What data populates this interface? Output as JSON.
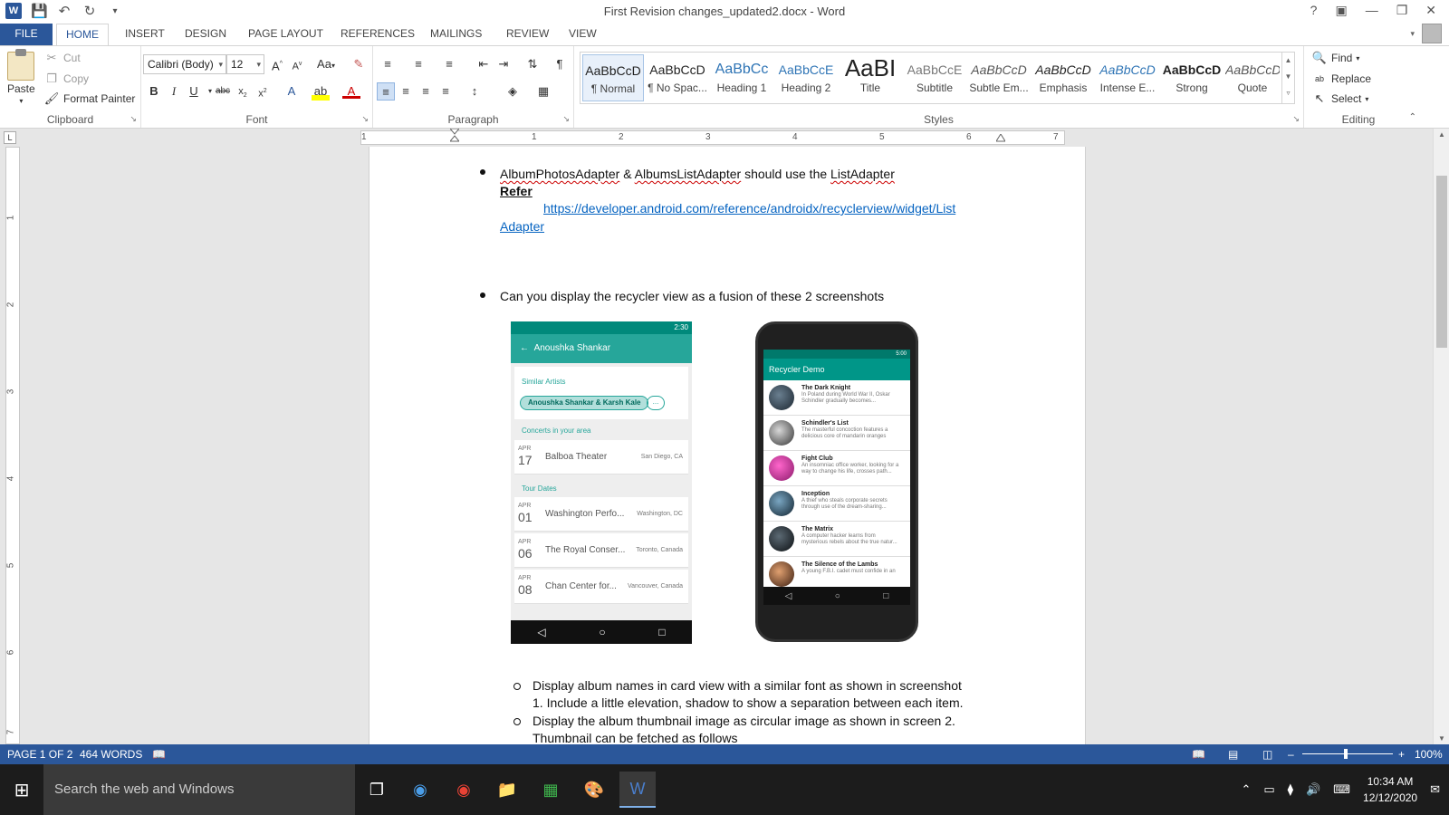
{
  "window": {
    "title": "First Revision changes_updated2.docx - Word",
    "controls": [
      "?",
      "▣",
      "—",
      "❐",
      "✕"
    ]
  },
  "qat": {
    "undo_icon": "undo-icon",
    "redo_icon": "redo-icon",
    "save_icon": "save-icon"
  },
  "tabs": [
    "FILE",
    "HOME",
    "INSERT",
    "DESIGN",
    "PAGE LAYOUT",
    "REFERENCES",
    "MAILINGS",
    "REVIEW",
    "VIEW"
  ],
  "clipboard": {
    "paste": "Paste",
    "cut": "Cut",
    "copy": "Copy",
    "format_painter": "Format Painter",
    "label": "Clipboard"
  },
  "font": {
    "family": "Calibri (Body)",
    "size": "12",
    "label": "Font",
    "case": "Aa"
  },
  "paragraph": {
    "label": "Paragraph"
  },
  "styles": {
    "label": "Styles",
    "items": [
      {
        "sample": "AaBbCcD",
        "name": "¶ Normal"
      },
      {
        "sample": "AaBbCcD",
        "name": "¶ No Spac..."
      },
      {
        "sample": "AaBbCc",
        "name": "Heading 1"
      },
      {
        "sample": "AaBbCcE",
        "name": "Heading 2"
      },
      {
        "sample": "AaBI",
        "name": "Title"
      },
      {
        "sample": "AaBbCcE",
        "name": "Subtitle"
      },
      {
        "sample": "AaBbCcD",
        "name": "Subtle Em..."
      },
      {
        "sample": "AaBbCcD",
        "name": "Emphasis"
      },
      {
        "sample": "AaBbCcD",
        "name": "Intense E..."
      },
      {
        "sample": "AaBbCcD",
        "name": "Strong"
      },
      {
        "sample": "AaBbCcD",
        "name": "Quote"
      }
    ]
  },
  "editing": {
    "find": "Find",
    "replace": "Replace",
    "select": "Select",
    "label": "Editing"
  },
  "ruler": {
    "marks": [
      "1",
      "1",
      "2",
      "3",
      "4",
      "5",
      "6",
      "7"
    ],
    "vmarks": [
      "1",
      "2",
      "3",
      "4",
      "5",
      "6",
      "7"
    ]
  },
  "document": {
    "bullet1": {
      "adapter1": "AlbumPhotosAdapter",
      "amp": "&",
      "adapter2": "AlbumsListAdapter",
      "rest": "should use the",
      "listadapter": "ListAdapter",
      "refer": "Refer",
      "link_line1": "https://developer.android.com/reference/androidx/recyclerview/widget/List",
      "link_line2": "Adapter"
    },
    "bullet2": "Can you display the recycler view as a fusion of these 2 screenshots",
    "sub1_line1": "Display album names in card view with a similar font as shown in screenshot",
    "sub1_line2": "1. Include a little elevation, shadow to show a separation between each item.",
    "sub2_line1": "Display  the album thumbnail image as circular image as shown in screen 2.",
    "sub2_line2": "Thumbnail can be fetched as follows"
  },
  "screenshot1": {
    "time": "2:30",
    "toolbar_title": "Anoushka Shankar",
    "similar_artists": "Similar Artists",
    "chip": "Anoushka Shankar & Karsh Kale",
    "chip_more": "...",
    "concerts_title": "Concerts in your area",
    "tour_title": "Tour Dates",
    "concert": {
      "month": "APR",
      "day": "17",
      "venue": "Balboa Theater",
      "location": "San Diego, CA"
    },
    "tour": [
      {
        "month": "APR",
        "day": "01",
        "venue": "Washington Perfo...",
        "location": "Washington, DC"
      },
      {
        "month": "APR",
        "day": "06",
        "venue": "The Royal Conser...",
        "location": "Toronto, Canada"
      },
      {
        "month": "APR",
        "day": "08",
        "venue": "Chan Center for...",
        "location": "Vancouver, Canada"
      }
    ]
  },
  "screenshot2": {
    "time": "5:00",
    "toolbar_title": "Recycler Demo",
    "movies": [
      {
        "title": "The Dark Knight",
        "desc": "In Poland during World War II, Oskar Schindler gradually becomes..."
      },
      {
        "title": "Schindler's List",
        "desc": "The masterful concoction features a delicious core of mandarin oranges"
      },
      {
        "title": "Fight Club",
        "desc": "An insomniac office worker, looking for a way to change his life, crosses path..."
      },
      {
        "title": "Inception",
        "desc": "A thief who steals corporate secrets through use of the dream-sharing..."
      },
      {
        "title": "The Matrix",
        "desc": "A computer hacker learns from mysterious rebels about the true natur..."
      },
      {
        "title": "The Silence of the Lambs",
        "desc": "A young F.B.I. cadet must confide in an"
      }
    ]
  },
  "statusbar": {
    "page": "PAGE 1 OF 2",
    "words": "464 WORDS",
    "zoom": "100%"
  },
  "taskbar": {
    "search_placeholder": "Search the web and Windows",
    "time": "10:34 AM",
    "date": "12/12/2020"
  },
  "colors": {
    "accent": "#2b579a",
    "teal": "#26a69a",
    "link": "#0563c1"
  }
}
